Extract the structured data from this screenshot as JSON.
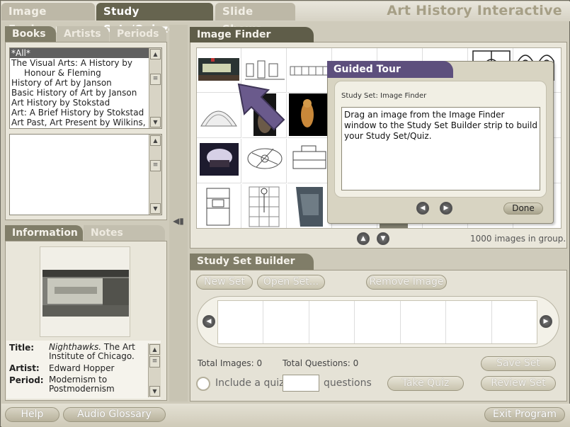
{
  "top_tabs": [
    {
      "label": "Image Explorer"
    },
    {
      "label": "Study Sets/Quizzes"
    },
    {
      "label": "Slide Shows"
    }
  ],
  "brand": "Art History Interactive",
  "left_tabs": [
    {
      "label": "Books"
    },
    {
      "label": "Artists"
    },
    {
      "label": "Periods"
    }
  ],
  "books": [
    "*All*",
    "The Visual Arts: A History by",
    "Honour & Fleming",
    "History of Art by Janson",
    "Basic History of Art by Janson",
    "Art History by Stokstad",
    "Art: A Brief History by Stokstad",
    "Art Past, Art Present by Wilkins,"
  ],
  "info_tabs": [
    {
      "label": "Information"
    },
    {
      "label": "Notes"
    }
  ],
  "info": {
    "title_label": "Title:",
    "title_italic": "Nighthawks.",
    "title_rest": "The Art Institute of Chicago.",
    "artist_label": "Artist:",
    "artist_value": "Edward Hopper",
    "period_label": "Period:",
    "period_value": "Modernism to Postmodernism"
  },
  "image_finder": {
    "title": "Image Finder",
    "count_text": "1000 images in group."
  },
  "guided_tour": {
    "title": "Guided Tour",
    "subtitle": "Study Set: Image Finder",
    "body": "Drag an image from the Image Finder window to the Study Set Builder strip to build your Study Set/Quiz.",
    "done_label": "Done"
  },
  "builder": {
    "title": "Study Set Builder",
    "new_set": "New Set",
    "open_set": "Open Set...",
    "remove_image": "Remove Image",
    "total_images": "Total Images: 0",
    "total_questions": "Total Questions: 0",
    "include_quiz": "Include a quiz:",
    "questions": "questions",
    "take_quiz": "Take Quiz",
    "save_set": "Save Set",
    "review_set": "Review Set"
  },
  "bottom": {
    "help": "Help",
    "audio_glossary": "Audio Glossary",
    "exit_program": "Exit Program"
  }
}
